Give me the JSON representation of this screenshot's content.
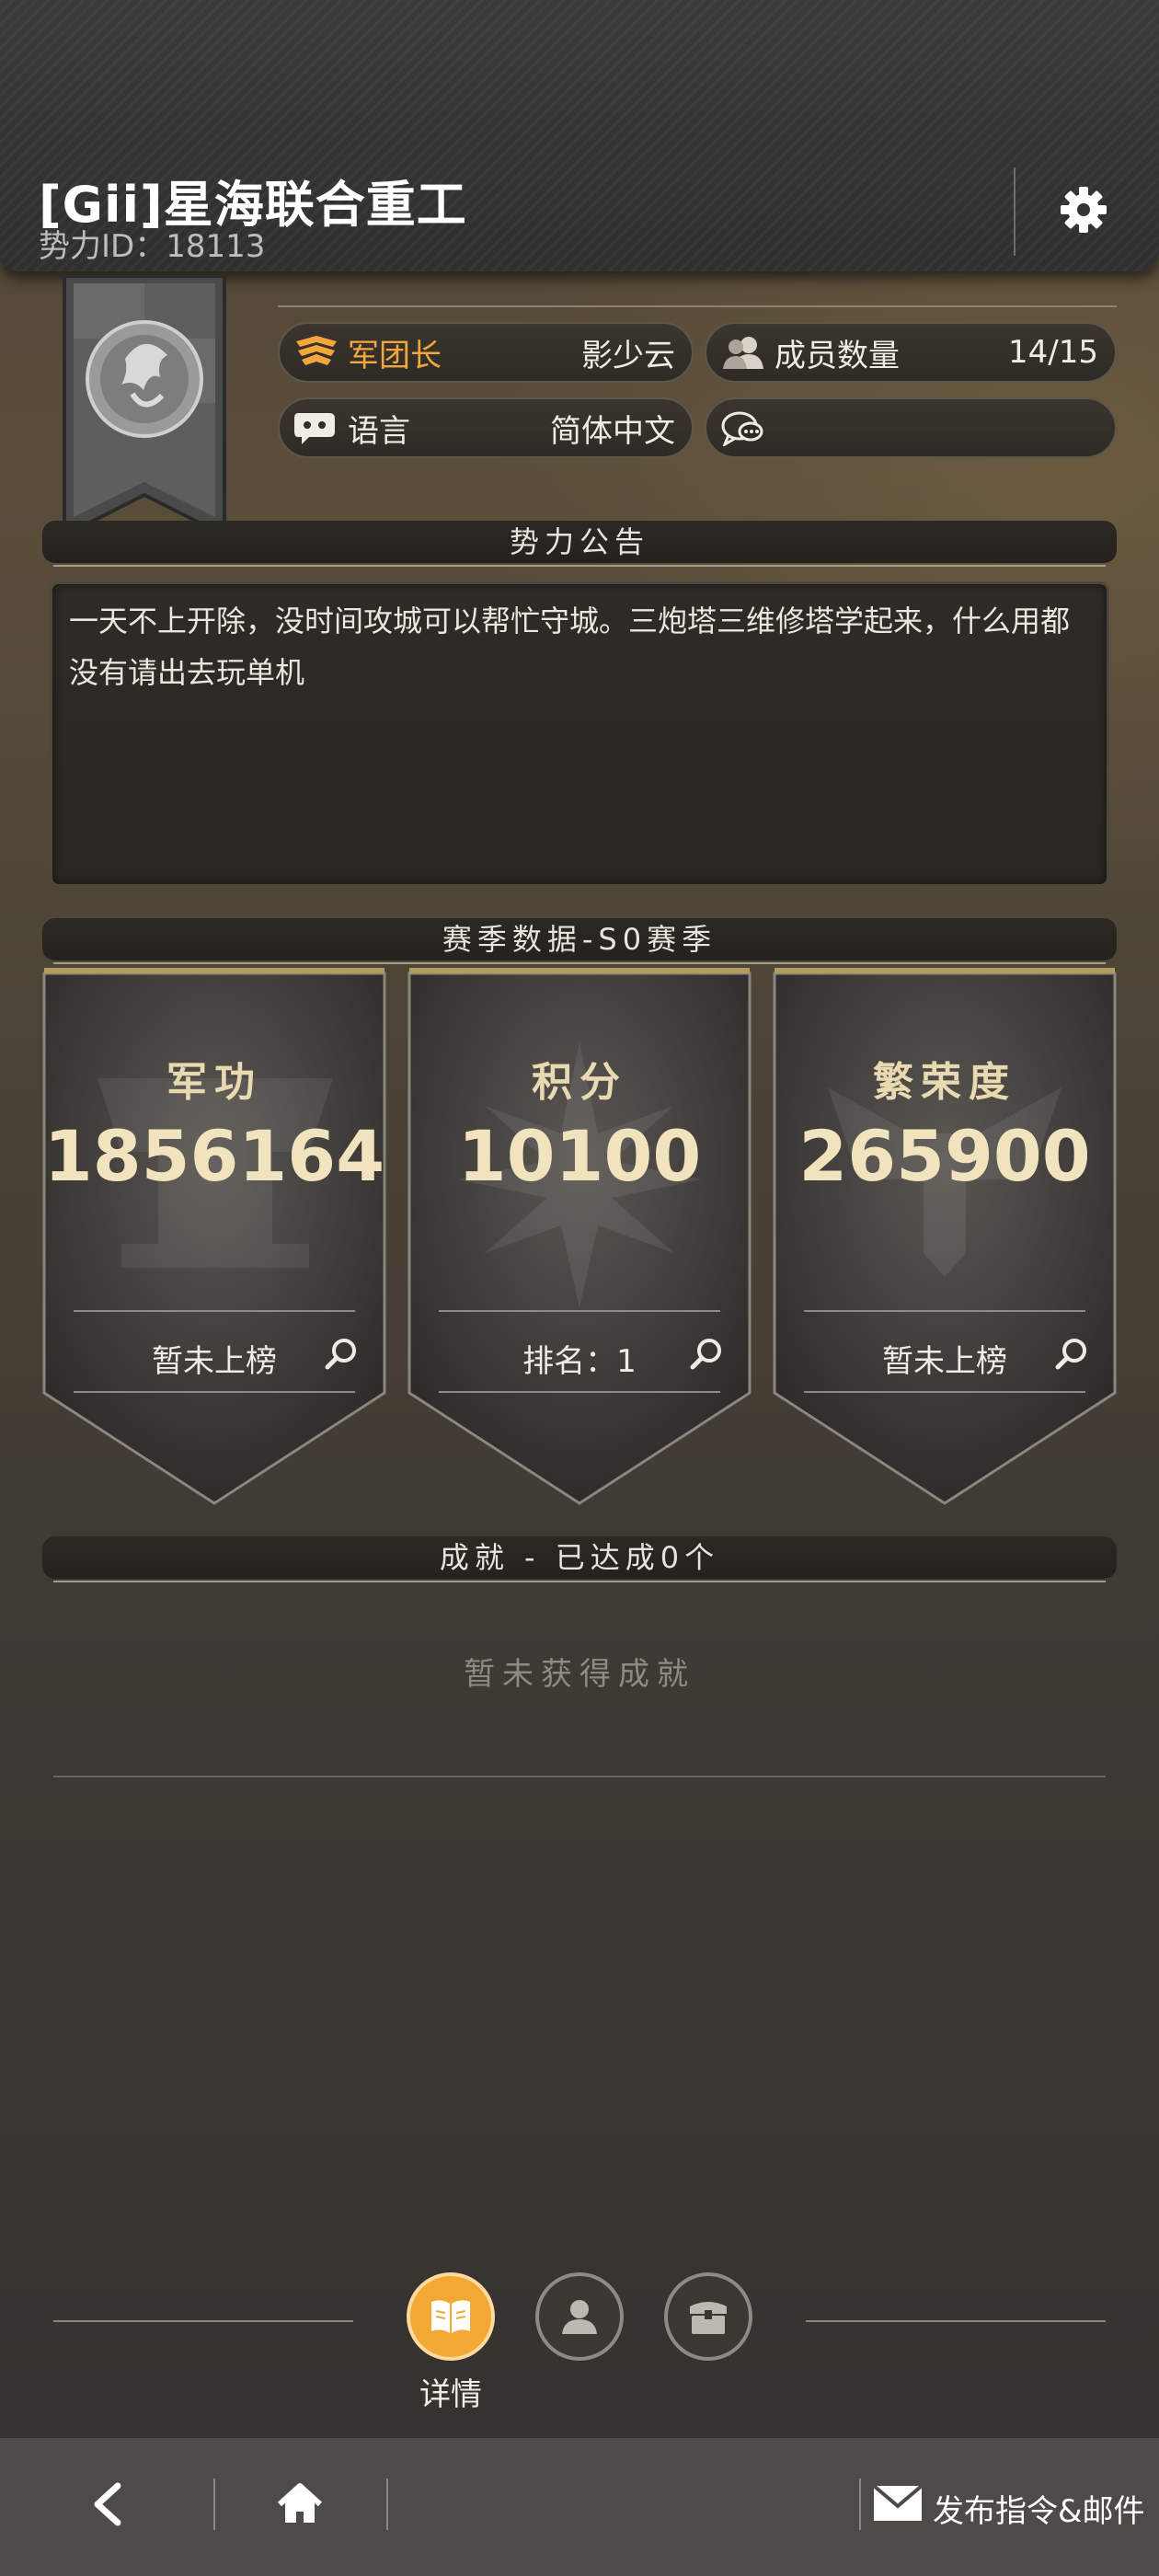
{
  "header": {
    "title": "[Gii]星海联合重工",
    "faction_id": "势力ID：18113",
    "settings_icon": "gear-icon"
  },
  "info": {
    "leader_label": "军团长",
    "leader_value": "影少云",
    "members_label": "成员数量",
    "members_value": "14/15",
    "language_label": "语言",
    "language_value": "简体中文",
    "chat_icon": "chat-bubble-icon"
  },
  "announcement": {
    "title": "势力公告",
    "text": "一天不上开除，没时间攻城可以帮忙守城。三炮塔三维修塔学起来，什么用都没有请出去玩单机"
  },
  "season": {
    "title": "赛季数据-S0赛季",
    "cards": [
      {
        "label": "军功",
        "value": "1856164",
        "rank": "暂未上榜"
      },
      {
        "label": "积分",
        "value": "10100",
        "rank": "排名：1"
      },
      {
        "label": "繁荣度",
        "value": "265900",
        "rank": "暂未上榜"
      }
    ]
  },
  "achievements": {
    "title": "成就 - 已达成0个",
    "empty_text": "暂未获得成就"
  },
  "tabs": {
    "active_label": "详情",
    "active_color": "#f4a834"
  },
  "nav": {
    "mail_label": "发布指令&邮件"
  }
}
